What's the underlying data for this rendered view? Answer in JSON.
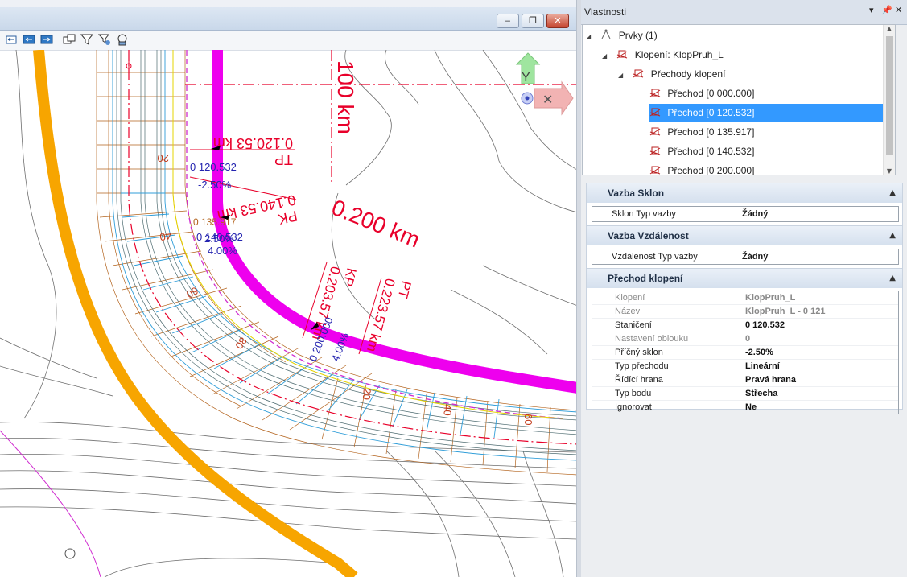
{
  "viewport": {
    "window_buttons": {
      "minimize": "‒",
      "restore": "❐",
      "close": "✕"
    },
    "toolbar_icons": [
      "view-previous-icon",
      "view-back-icon",
      "view-forward-icon",
      "copy-view-icon",
      "filter-icon",
      "select-filter-icon",
      "select-all-icon"
    ],
    "labels": {
      "station_100": "100 km",
      "station_200": "0.200 km",
      "tp": "TP",
      "tp_station": "0.120.53 km",
      "pk": "PK",
      "pk_station": "0.140.53 km",
      "kp": "KP",
      "kp_station": "0.203.57 km",
      "pt": "PT",
      "pt_station": "0.223.57 km",
      "sta_120": "0 120.532",
      "slope_120": "-2.50%",
      "sta_135": "0 135.917",
      "sta_140": "0 140.532",
      "slope_140a": "2.50%",
      "slope_140b": "4.00%",
      "sta_200": "0 200.000",
      "slope_200": "4.00%",
      "tick_20a": "20",
      "tick_40": "40",
      "tick_60": "60",
      "tick_80": "80",
      "tick_20b": "20",
      "tick_40b": "40",
      "tick_60b": "60"
    },
    "view_cube": {
      "y_label": "Y",
      "x_label": "✕"
    },
    "colors": {
      "centerline": "#e8002a",
      "magenta_alignment": "#ee00ee",
      "orange_alignment": "#f7a500",
      "edge_lines": "#2f9dd8",
      "hatch": "#b3631d",
      "blue_text": "#2424b0"
    }
  },
  "panel": {
    "title": "Vlastnosti",
    "controls": {
      "dropdown": "▾",
      "pin": "📌",
      "close": "✕"
    },
    "tree": [
      {
        "label": "Prvky (1)",
        "level": 0,
        "expanded": true,
        "selected": false
      },
      {
        "label": "Klopení: KlopPruh_L",
        "level": 1,
        "expanded": true,
        "selected": false
      },
      {
        "label": "Přechody klopení",
        "level": 2,
        "expanded": true,
        "selected": false
      },
      {
        "label": "Přechod [0 000.000]",
        "level": 3,
        "expanded": false,
        "selected": false
      },
      {
        "label": "Přechod [0 120.532]",
        "level": 3,
        "expanded": false,
        "selected": true
      },
      {
        "label": "Přechod [0 135.917]",
        "level": 3,
        "expanded": false,
        "selected": false
      },
      {
        "label": "Přechod [0 140.532]",
        "level": 3,
        "expanded": false,
        "selected": false
      },
      {
        "label": "Přechod [0 200.000]",
        "level": 3,
        "expanded": false,
        "selected": false
      }
    ],
    "sections": {
      "sklon": {
        "title": "Vazba Sklon",
        "row": {
          "key": "Sklon Typ vazby",
          "value": "Žádný"
        }
      },
      "vzdalenost": {
        "title": "Vazba Vzdálenost",
        "row": {
          "key": "Vzdálenost Typ vazby",
          "value": "Žádný"
        }
      },
      "prechod": {
        "title": "Přechod klopení",
        "rows": [
          {
            "key": "Klopení",
            "value": "KlopPruh_L",
            "disabled": true
          },
          {
            "key": "Název",
            "value": "KlopPruh_L - 0 121",
            "disabled": true
          },
          {
            "key": "Staničení",
            "value": "0 120.532",
            "disabled": false
          },
          {
            "key": "Nastavení oblouku",
            "value": "0",
            "disabled": true
          },
          {
            "key": "Příčný sklon",
            "value": "-2.50%",
            "disabled": false
          },
          {
            "key": "Typ přechodu",
            "value": "Lineární",
            "disabled": false
          },
          {
            "key": "Řídící hrana",
            "value": "Pravá hrana",
            "disabled": false
          },
          {
            "key": "Typ bodu",
            "value": "Střecha",
            "disabled": false
          },
          {
            "key": "Ignorovat",
            "value": "Ne",
            "disabled": false
          }
        ]
      }
    }
  }
}
